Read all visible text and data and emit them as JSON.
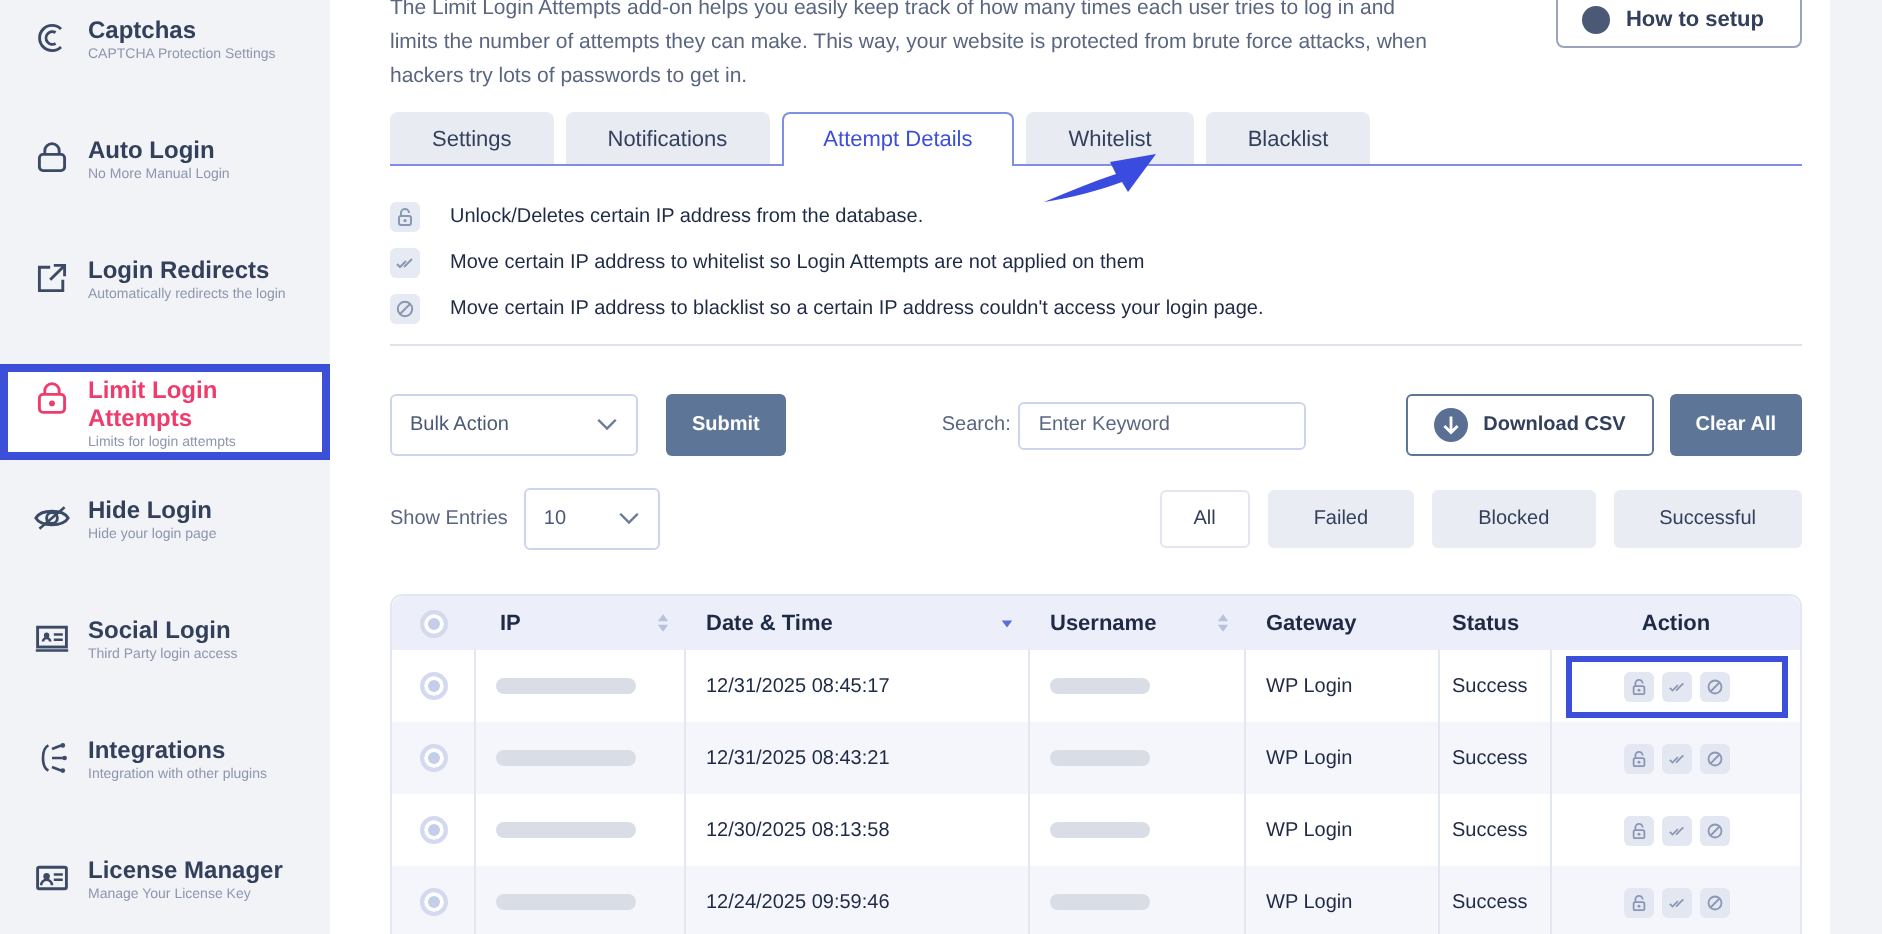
{
  "sidebar": {
    "items": [
      {
        "title": "Captchas",
        "subtitle": "CAPTCHA Protection Settings",
        "kind": "captcha",
        "selected": false,
        "highlighted": false
      },
      {
        "title": "Auto Login",
        "subtitle": "No More Manual Login",
        "kind": "autologin",
        "selected": false,
        "highlighted": false
      },
      {
        "title": "Login Redirects",
        "subtitle": "Automatically redirects the login",
        "kind": "redirect",
        "selected": false,
        "highlighted": false
      },
      {
        "title": "Limit Login Attempts",
        "subtitle": "Limits for login attempts",
        "kind": "lock",
        "selected": true,
        "highlighted": true
      },
      {
        "title": "Hide Login",
        "subtitle": "Hide your login page",
        "kind": "eye",
        "selected": false,
        "highlighted": false
      },
      {
        "title": "Social Login",
        "subtitle": "Third Party login access",
        "kind": "card",
        "selected": false,
        "highlighted": false
      },
      {
        "title": "Integrations",
        "subtitle": "Integration with other plugins",
        "kind": "integrations",
        "selected": false,
        "highlighted": false
      },
      {
        "title": "License Manager",
        "subtitle": "Manage Your License Key",
        "kind": "license",
        "selected": false,
        "highlighted": false
      }
    ]
  },
  "intro": "The Limit Login Attempts add-on helps you easily keep track of how many times each user tries to log in and limits the number of attempts they can make. This way, your website is protected from brute force attacks, when hackers try lots of passwords to get in.",
  "how_to_button": "How to setup",
  "tabs": [
    {
      "label": "Settings",
      "selected": false
    },
    {
      "label": "Notifications",
      "selected": false
    },
    {
      "label": "Attempt Details",
      "selected": true
    },
    {
      "label": "Whitelist",
      "selected": false
    },
    {
      "label": "Blacklist",
      "selected": false
    }
  ],
  "legend": [
    {
      "kind": "unlock",
      "text": "Unlock/Deletes certain IP address from the database."
    },
    {
      "kind": "whitelist",
      "text": "Move certain IP address to whitelist so Login Attempts are not applied on them"
    },
    {
      "kind": "blacklist",
      "text": "Move certain IP address to blacklist so a certain IP address couldn't access your login page."
    }
  ],
  "bulk_action": {
    "value": "Bulk Action"
  },
  "submit_button": "Submit",
  "search": {
    "label": "Search:",
    "placeholder": "Enter Keyword"
  },
  "download_button": "Download CSV",
  "clear_button": "Clear All",
  "show_entries": {
    "label": "Show Entries",
    "value": "10"
  },
  "filters": [
    {
      "label": "All",
      "selected": true
    },
    {
      "label": "Failed",
      "selected": false
    },
    {
      "label": "Blocked",
      "selected": false
    },
    {
      "label": "Successful",
      "selected": false
    }
  ],
  "table": {
    "all_selected": false,
    "columns": [
      {
        "label": "IP",
        "sortable": true,
        "sorted": false
      },
      {
        "label": "Date & Time",
        "sortable": true,
        "sorted": true
      },
      {
        "label": "Username",
        "sortable": true,
        "sorted": false
      },
      {
        "label": "Gateway",
        "sortable": false,
        "sorted": false
      },
      {
        "label": "Status",
        "sortable": false,
        "sorted": false
      },
      {
        "label": "Action",
        "sortable": false,
        "sorted": false
      }
    ],
    "rows": [
      {
        "date": "12/31/2025 08:45:17",
        "gateway": "WP Login",
        "status": "Success",
        "selected": false,
        "highlighted": true
      },
      {
        "date": "12/31/2025 08:43:21",
        "gateway": "WP Login",
        "status": "Success",
        "selected": false,
        "highlighted": false
      },
      {
        "date": "12/30/2025 08:13:58",
        "gateway": "WP Login",
        "status": "Success",
        "selected": false,
        "highlighted": false
      },
      {
        "date": "12/24/2025 09:59:46",
        "gateway": "WP Login",
        "status": "Success",
        "selected": false,
        "highlighted": false
      }
    ]
  }
}
